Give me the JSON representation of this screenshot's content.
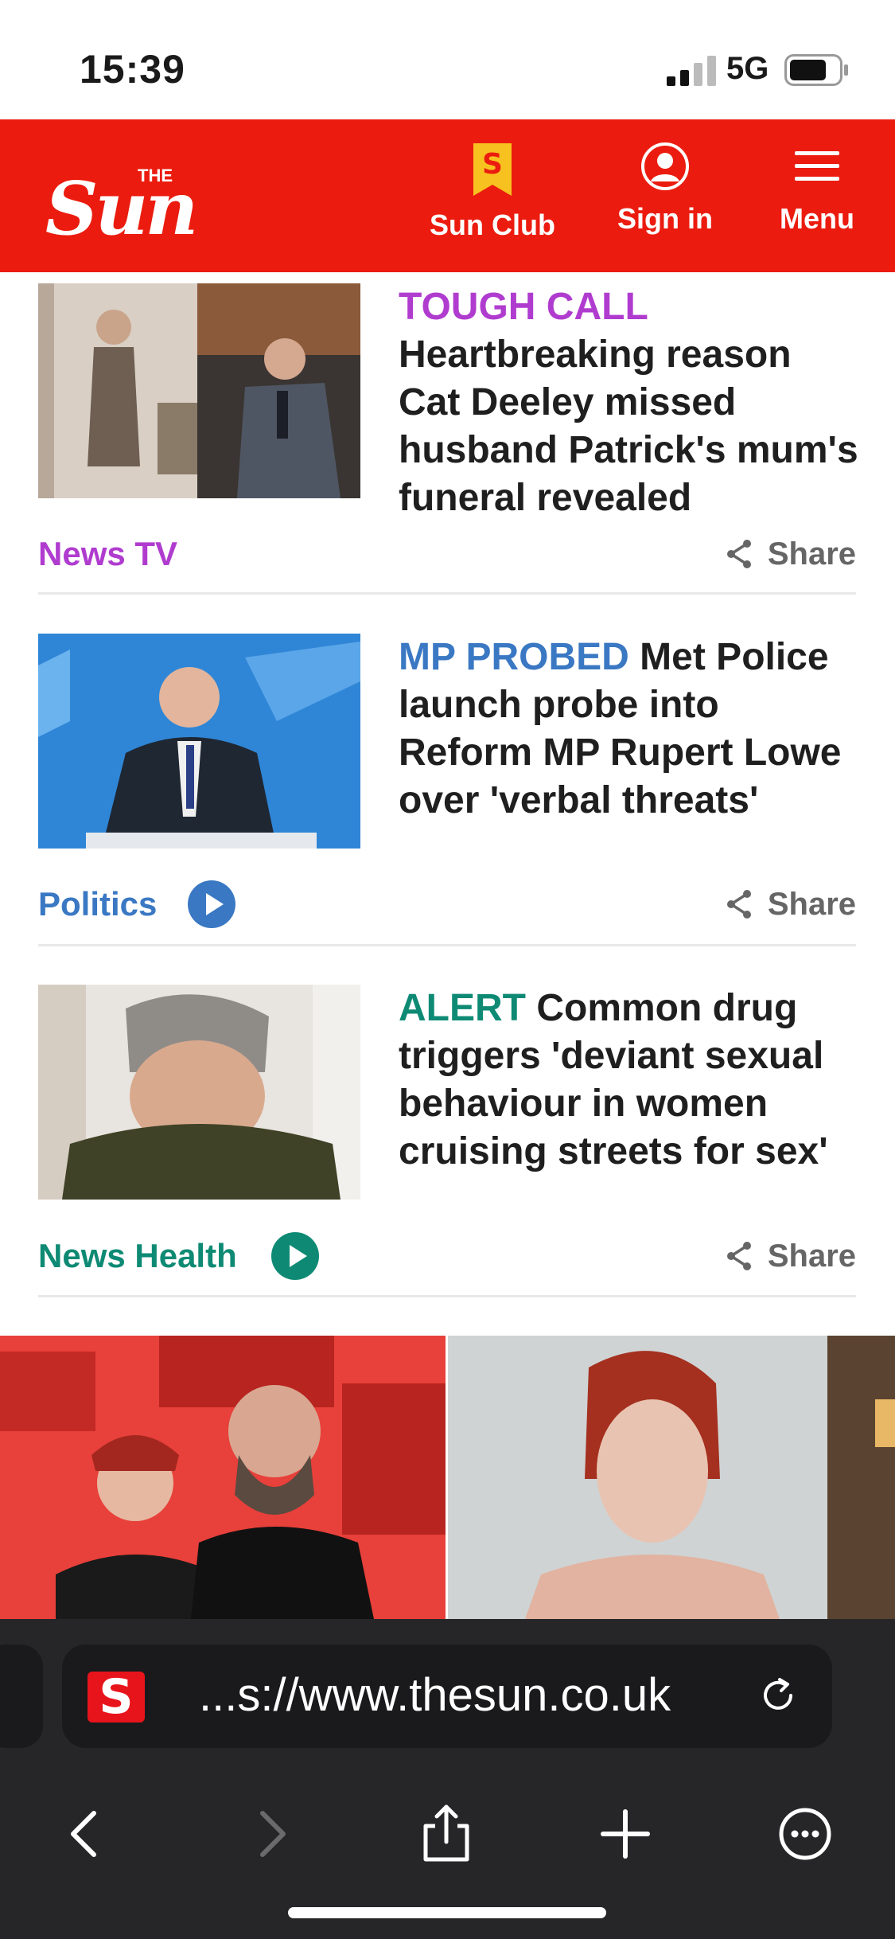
{
  "status_bar": {
    "time": "15:39",
    "network": "5G"
  },
  "header": {
    "logo_alt": "The Sun",
    "logo_text": "Sun",
    "logo_small": "THE",
    "nav": [
      {
        "label": "Sun Club",
        "icon": "sun-club-icon"
      },
      {
        "label": "Sign in",
        "icon": "user-icon"
      },
      {
        "label": "Menu",
        "icon": "hamburger-icon"
      }
    ]
  },
  "articles": [
    {
      "kicker": "TOUGH CALL",
      "kicker_color": "#b03ccf",
      "headline": "Heartbreaking reason Cat Deeley missed husband Patrick's mum's funeral revealed",
      "section": "News TV",
      "section_color": "#b03ccf",
      "has_video": false,
      "share": "Share"
    },
    {
      "kicker": "MP PROBED",
      "kicker_color": "#3a78c3",
      "headline": "Met Police launch probe into Reform MP Rupert Lowe over 'verbal threats'",
      "section": "Politics",
      "section_color": "#3a78c3",
      "has_video": true,
      "share": "Share"
    },
    {
      "kicker": "ALERT",
      "kicker_color": "#0e8a74",
      "headline": "Common drug triggers 'deviant sexual behaviour in women cruising streets for sex'",
      "section": "News Health",
      "section_color": "#0e8a74",
      "has_video": true,
      "share": "Share"
    }
  ],
  "browser": {
    "url": "...s://www.thesun.co.uk",
    "favicon": "S"
  },
  "colors": {
    "brand": "#eb1c0f",
    "club": "#f7c11f"
  }
}
